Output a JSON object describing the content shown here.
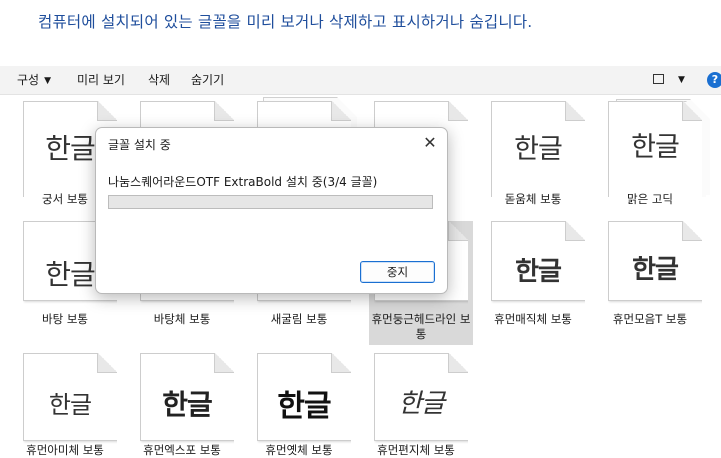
{
  "header": {
    "text": "컴퓨터에 설치되어 있는 글꼴을 미리 보거나 삭제하고 표시하거나 숨깁니다."
  },
  "toolbar": {
    "organize": "구성",
    "preview": "미리 보기",
    "delete": "삭제",
    "hide": "숨기기",
    "help": "?"
  },
  "fonts": {
    "row1": [
      {
        "glyph": "한글",
        "label": "궁서 보통"
      },
      {
        "glyph": "",
        "label": ""
      },
      {
        "glyph": "",
        "label": ""
      },
      {
        "glyph": "",
        "label": ""
      },
      {
        "glyph": "한글",
        "label": "돋움체 보통"
      },
      {
        "glyph": "한글",
        "label": "맑은 고딕"
      }
    ],
    "row2": [
      {
        "glyph": "한글",
        "label": "바탕 보통"
      },
      {
        "glyph": "",
        "label": "바탕체 보통"
      },
      {
        "glyph": "",
        "label": "새굴림 보통"
      },
      {
        "glyph": "",
        "label": "휴먼둥근헤드라인 보통"
      },
      {
        "glyph": "한글",
        "label": "휴먼매직체 보통"
      },
      {
        "glyph": "한글",
        "label": "휴먼모음T 보통"
      }
    ],
    "row3": [
      {
        "glyph": "한글",
        "label": "휴먼아미체 보통"
      },
      {
        "glyph": "한글",
        "label": "휴먼엑스포 보통"
      },
      {
        "glyph": "한글",
        "label": "휴먼옛체 보통"
      },
      {
        "glyph": "한글",
        "label": "휴먼편지체 보통"
      }
    ]
  },
  "dialog": {
    "title": "글꼴 설치 중",
    "close": "✕",
    "status": "나눔스퀘어라운드OTF ExtraBold 설치 중(3/4 글꼴)",
    "progress": 0,
    "stop": "중지"
  }
}
